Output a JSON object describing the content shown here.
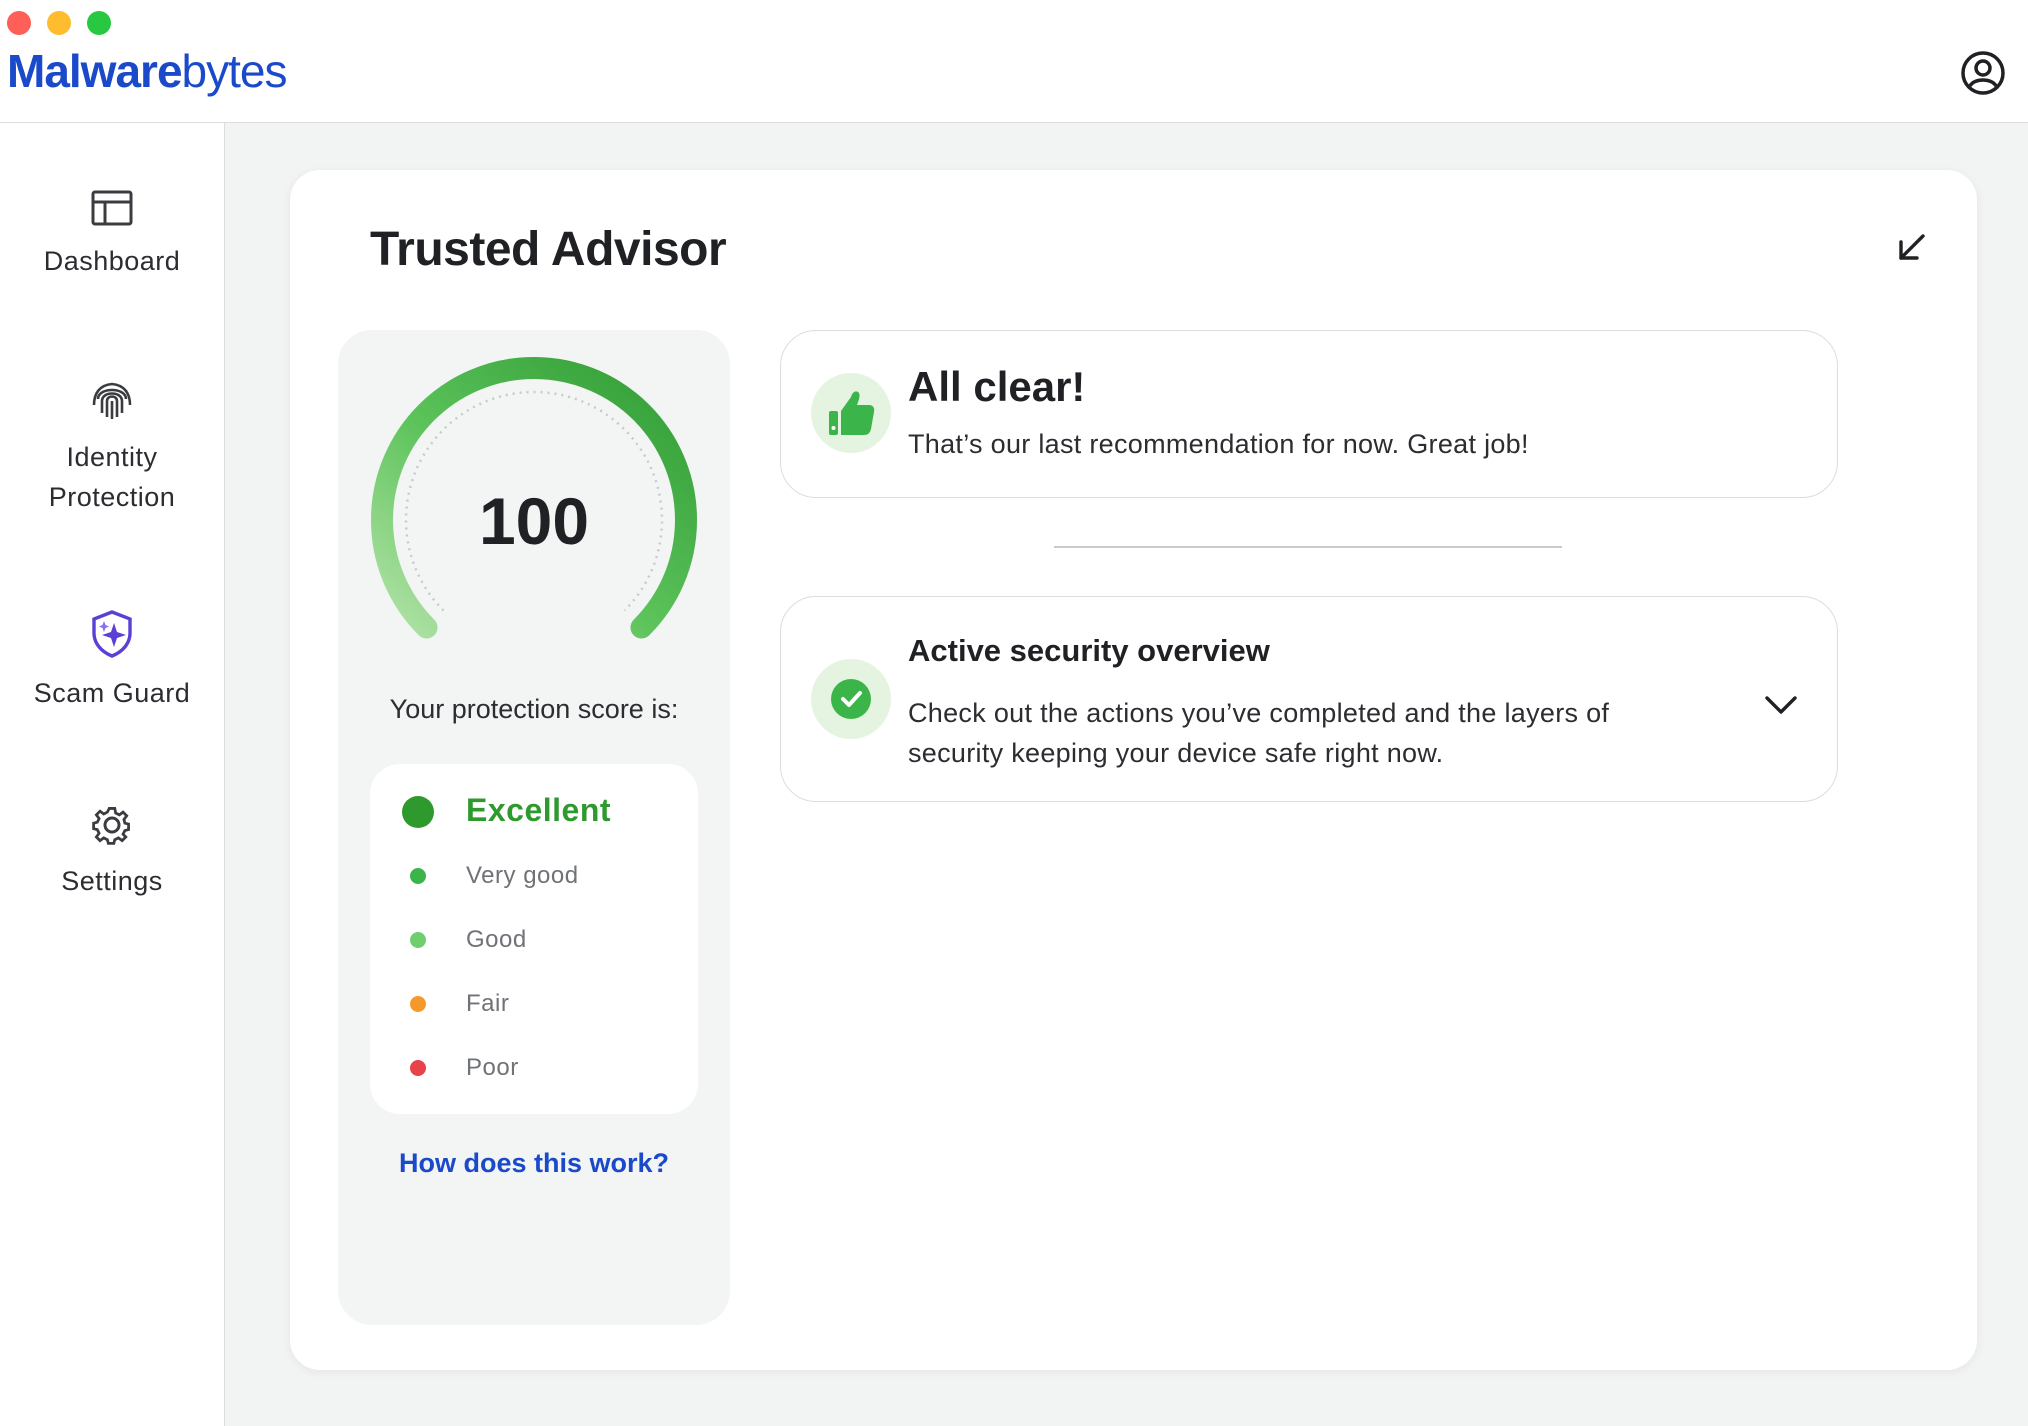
{
  "window": {
    "controls": [
      "close",
      "minimize",
      "maximize"
    ]
  },
  "header": {
    "logo_bold": "Malware",
    "logo_light": "bytes",
    "account_icon": "account-circle-icon"
  },
  "sidebar": {
    "items": [
      {
        "label": "Dashboard",
        "icon": "dashboard-icon"
      },
      {
        "label_line1": "Identity",
        "label_line2": "Protection",
        "icon": "fingerprint-icon"
      },
      {
        "label": "Scam Guard",
        "icon": "shield-sparkle-icon"
      },
      {
        "label": "Settings",
        "icon": "gear-icon"
      }
    ]
  },
  "main": {
    "title": "Trusted Advisor",
    "collapse_icon": "arrow-down-left-icon",
    "score": {
      "value": "100",
      "fill_fraction": 1.0,
      "label": "Your protection score is:",
      "levels": [
        {
          "label": "Excellent",
          "color": "#2e9a2e",
          "active": true
        },
        {
          "label": "Very good",
          "color": "#3bb54a",
          "active": false
        },
        {
          "label": "Good",
          "color": "#6fcf6f",
          "active": false
        },
        {
          "label": "Fair",
          "color": "#f59a2a",
          "active": false
        },
        {
          "label": "Poor",
          "color": "#e8424a",
          "active": false
        }
      ],
      "help_link": "How does this work?"
    },
    "recommendations": [
      {
        "title": "All clear!",
        "text": "That’s our last recommendation for now. Great job!",
        "icon": "thumbs-up-icon"
      },
      {
        "title": "Active security overview",
        "text_line1": "Check out the actions you’ve completed and the layers of",
        "text_line2": "security keeping your device safe right now.",
        "icon": "check-circle-icon",
        "expand_icon": "chevron-down-icon"
      }
    ]
  },
  "colors": {
    "brand": "#1a49c9",
    "accent_green": "#2e9a2e",
    "scam_guard": "#5b3fd6"
  }
}
